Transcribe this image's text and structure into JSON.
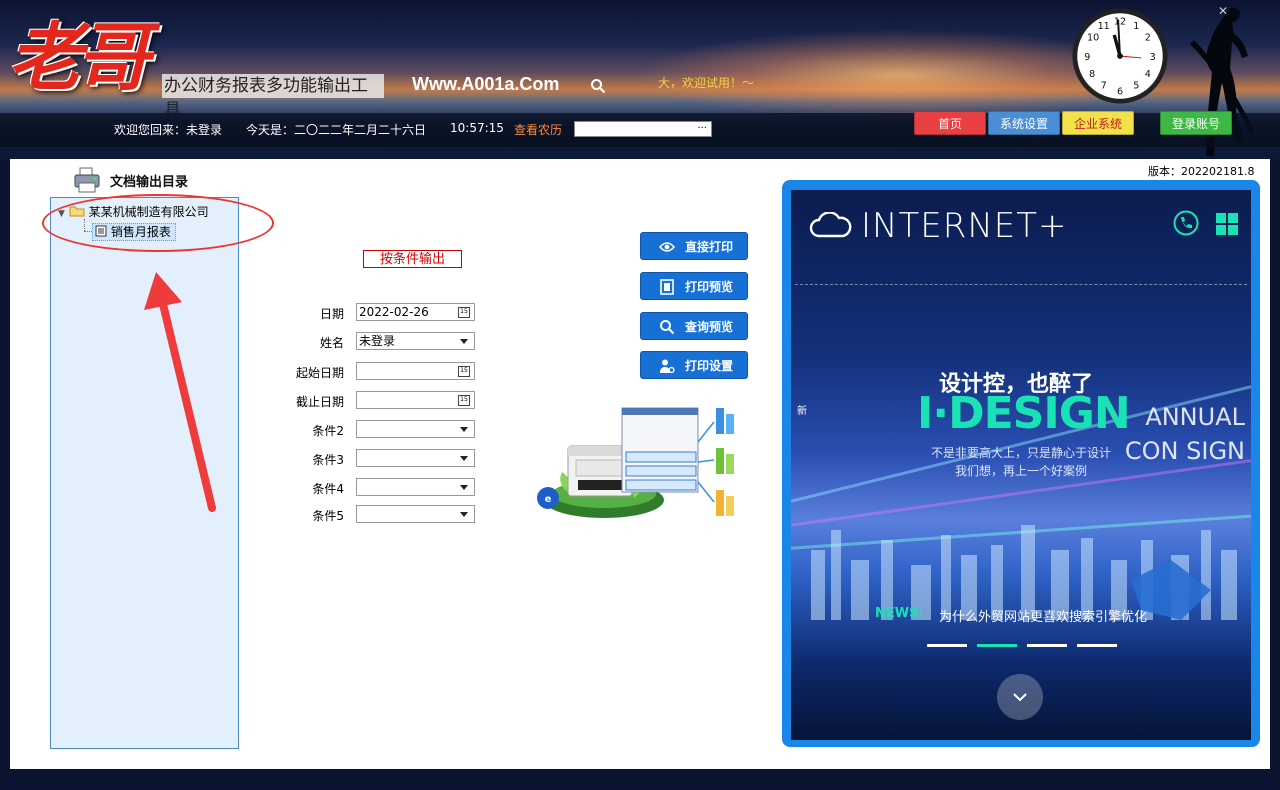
{
  "header": {
    "logo_text": "老哥",
    "app_title": "办公财务报表多功能输出工具",
    "website": "Www.A001a.Com",
    "search_icon": "search-icon",
    "marquee": "大，欢迎试用！～",
    "welcome": "欢迎您回来：未登录",
    "today": "今天是：二〇二二年二月二十六日",
    "time": "10:57:15",
    "lunar_link": "查看农历",
    "date_input_button": "···",
    "nav": {
      "home": "首页",
      "settings": "系统设置",
      "enterprise": "企业系统",
      "login": "登录账号"
    },
    "colors": {
      "home": "#e84040",
      "settings": "#4a8fd6",
      "enterprise": "#f2e24a",
      "login": "#3db845"
    }
  },
  "version": "版本：202202181.8",
  "tree": {
    "title": "文档输出目录",
    "title_icon": "printer-icon",
    "company": "某某机械制造有限公司",
    "company_icon": "folder-icon",
    "report": "销售月报表",
    "report_icon": "report-icon"
  },
  "form": {
    "output_button": "按条件输出",
    "fields": [
      {
        "label": "日期",
        "value": "2022-02-26",
        "type": "date"
      },
      {
        "label": "姓名",
        "value": "未登录",
        "type": "select"
      },
      {
        "label": "起始日期",
        "value": "",
        "type": "date"
      },
      {
        "label": "截止日期",
        "value": "",
        "type": "date"
      },
      {
        "label": "条件2",
        "value": "",
        "type": "select"
      },
      {
        "label": "条件3",
        "value": "",
        "type": "select"
      },
      {
        "label": "条件4",
        "value": "",
        "type": "select"
      },
      {
        "label": "条件5",
        "value": "",
        "type": "select"
      }
    ]
  },
  "actions": {
    "direct_print": "直接打印",
    "print_preview": "打印预览",
    "query_preview": "查询预览",
    "print_settings": "打印设置"
  },
  "banner": {
    "brand": "INTERNET+",
    "headline": "设计控，也醉了",
    "design": "I·DESIGN",
    "annual": "ANNUAL CON SIGN",
    "sub1": "不是非要高大上，只是静心于设计",
    "sub2": "我们想，再上一个好案例",
    "new_label": "新",
    "news_tag": "NEWS:",
    "news_text": "为什么外贸网站更喜欢搜索引擎优化"
  }
}
